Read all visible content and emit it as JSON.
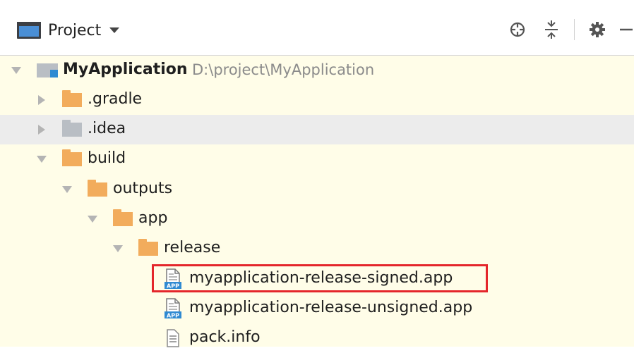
{
  "toolbar": {
    "project_label": "Project",
    "icons": [
      "locate-icon",
      "collapse-all-icon",
      "gear-icon",
      "minimize-icon"
    ]
  },
  "tree": {
    "root": {
      "label": "MyApplication",
      "path": "D:\\project\\MyApplication"
    },
    "gradle": ".gradle",
    "idea": ".idea",
    "build": "build",
    "outputs": "outputs",
    "app": "app",
    "release": "release",
    "signed": "myapplication-release-signed.app",
    "unsigned": "myapplication-release-unsigned.app",
    "packinfo": "pack.info",
    "app_badge": "APP"
  },
  "colors": {
    "tree_background": "#fffde8",
    "folder_orange": "#f2ac5c",
    "folder_grey": "#b9bec4",
    "highlight_box": "#e4262b"
  }
}
